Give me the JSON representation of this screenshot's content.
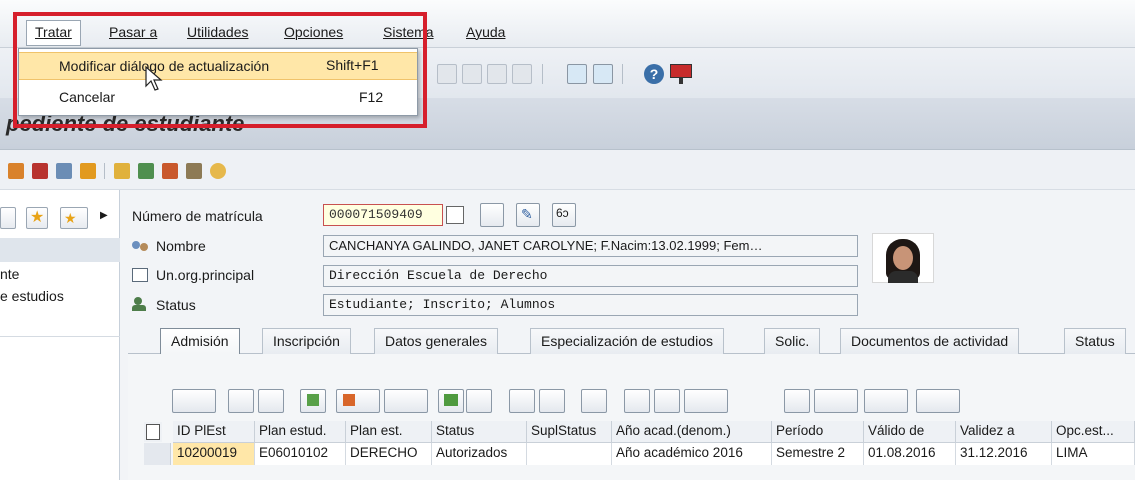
{
  "menu": {
    "items": [
      "Tratar",
      "Pasar a",
      "Utilidades",
      "Opciones",
      "Sistema",
      "Ayuda"
    ],
    "dropdown": [
      {
        "label": "Modificar diálogo de actualización",
        "shortcut": "Shift+F1"
      },
      {
        "label": "Cancelar",
        "shortcut": "F12"
      }
    ]
  },
  "page": {
    "title": "pediente de estudiante"
  },
  "left_nav": {
    "items": [
      "nte",
      "e estudios"
    ]
  },
  "form": {
    "matricula_label": "Número de matrícula",
    "matricula_value": "000071509409",
    "nombre_label": "Nombre",
    "nombre_value": "CANCHANYA GALINDO, JANET CAROLYNE; F.Nacim:13.02.1999; Fem…",
    "unorg_label": "Un.org.principal",
    "unorg_value": "Dirección Escuela de Derecho",
    "status_label": "Status",
    "status_value": "Estudiante; Inscrito; Alumnos"
  },
  "tabs": [
    "Admisión",
    "Inscripción",
    "Datos generales",
    "Especialización de estudios",
    "Solic.",
    "Documentos de actividad",
    "Status"
  ],
  "table": {
    "headers": [
      "ID PlEst",
      "Plan estud.",
      "Plan est.",
      "Status",
      "SuplStatus",
      "Año acad.(denom.)",
      "Período",
      "Válido de",
      "Validez a",
      "Opc.est..."
    ],
    "rows": [
      [
        "10200019",
        "E06010102",
        "DERECHO",
        "Autorizados",
        "",
        "Año académico 2016",
        "Semestre 2",
        "01.08.2016",
        "31.12.2016",
        "LIMA"
      ]
    ]
  },
  "colors": {
    "highlight": "#ffe7a8",
    "red_frame": "#d61f2c",
    "selected_cell": "#ffe7a8"
  }
}
